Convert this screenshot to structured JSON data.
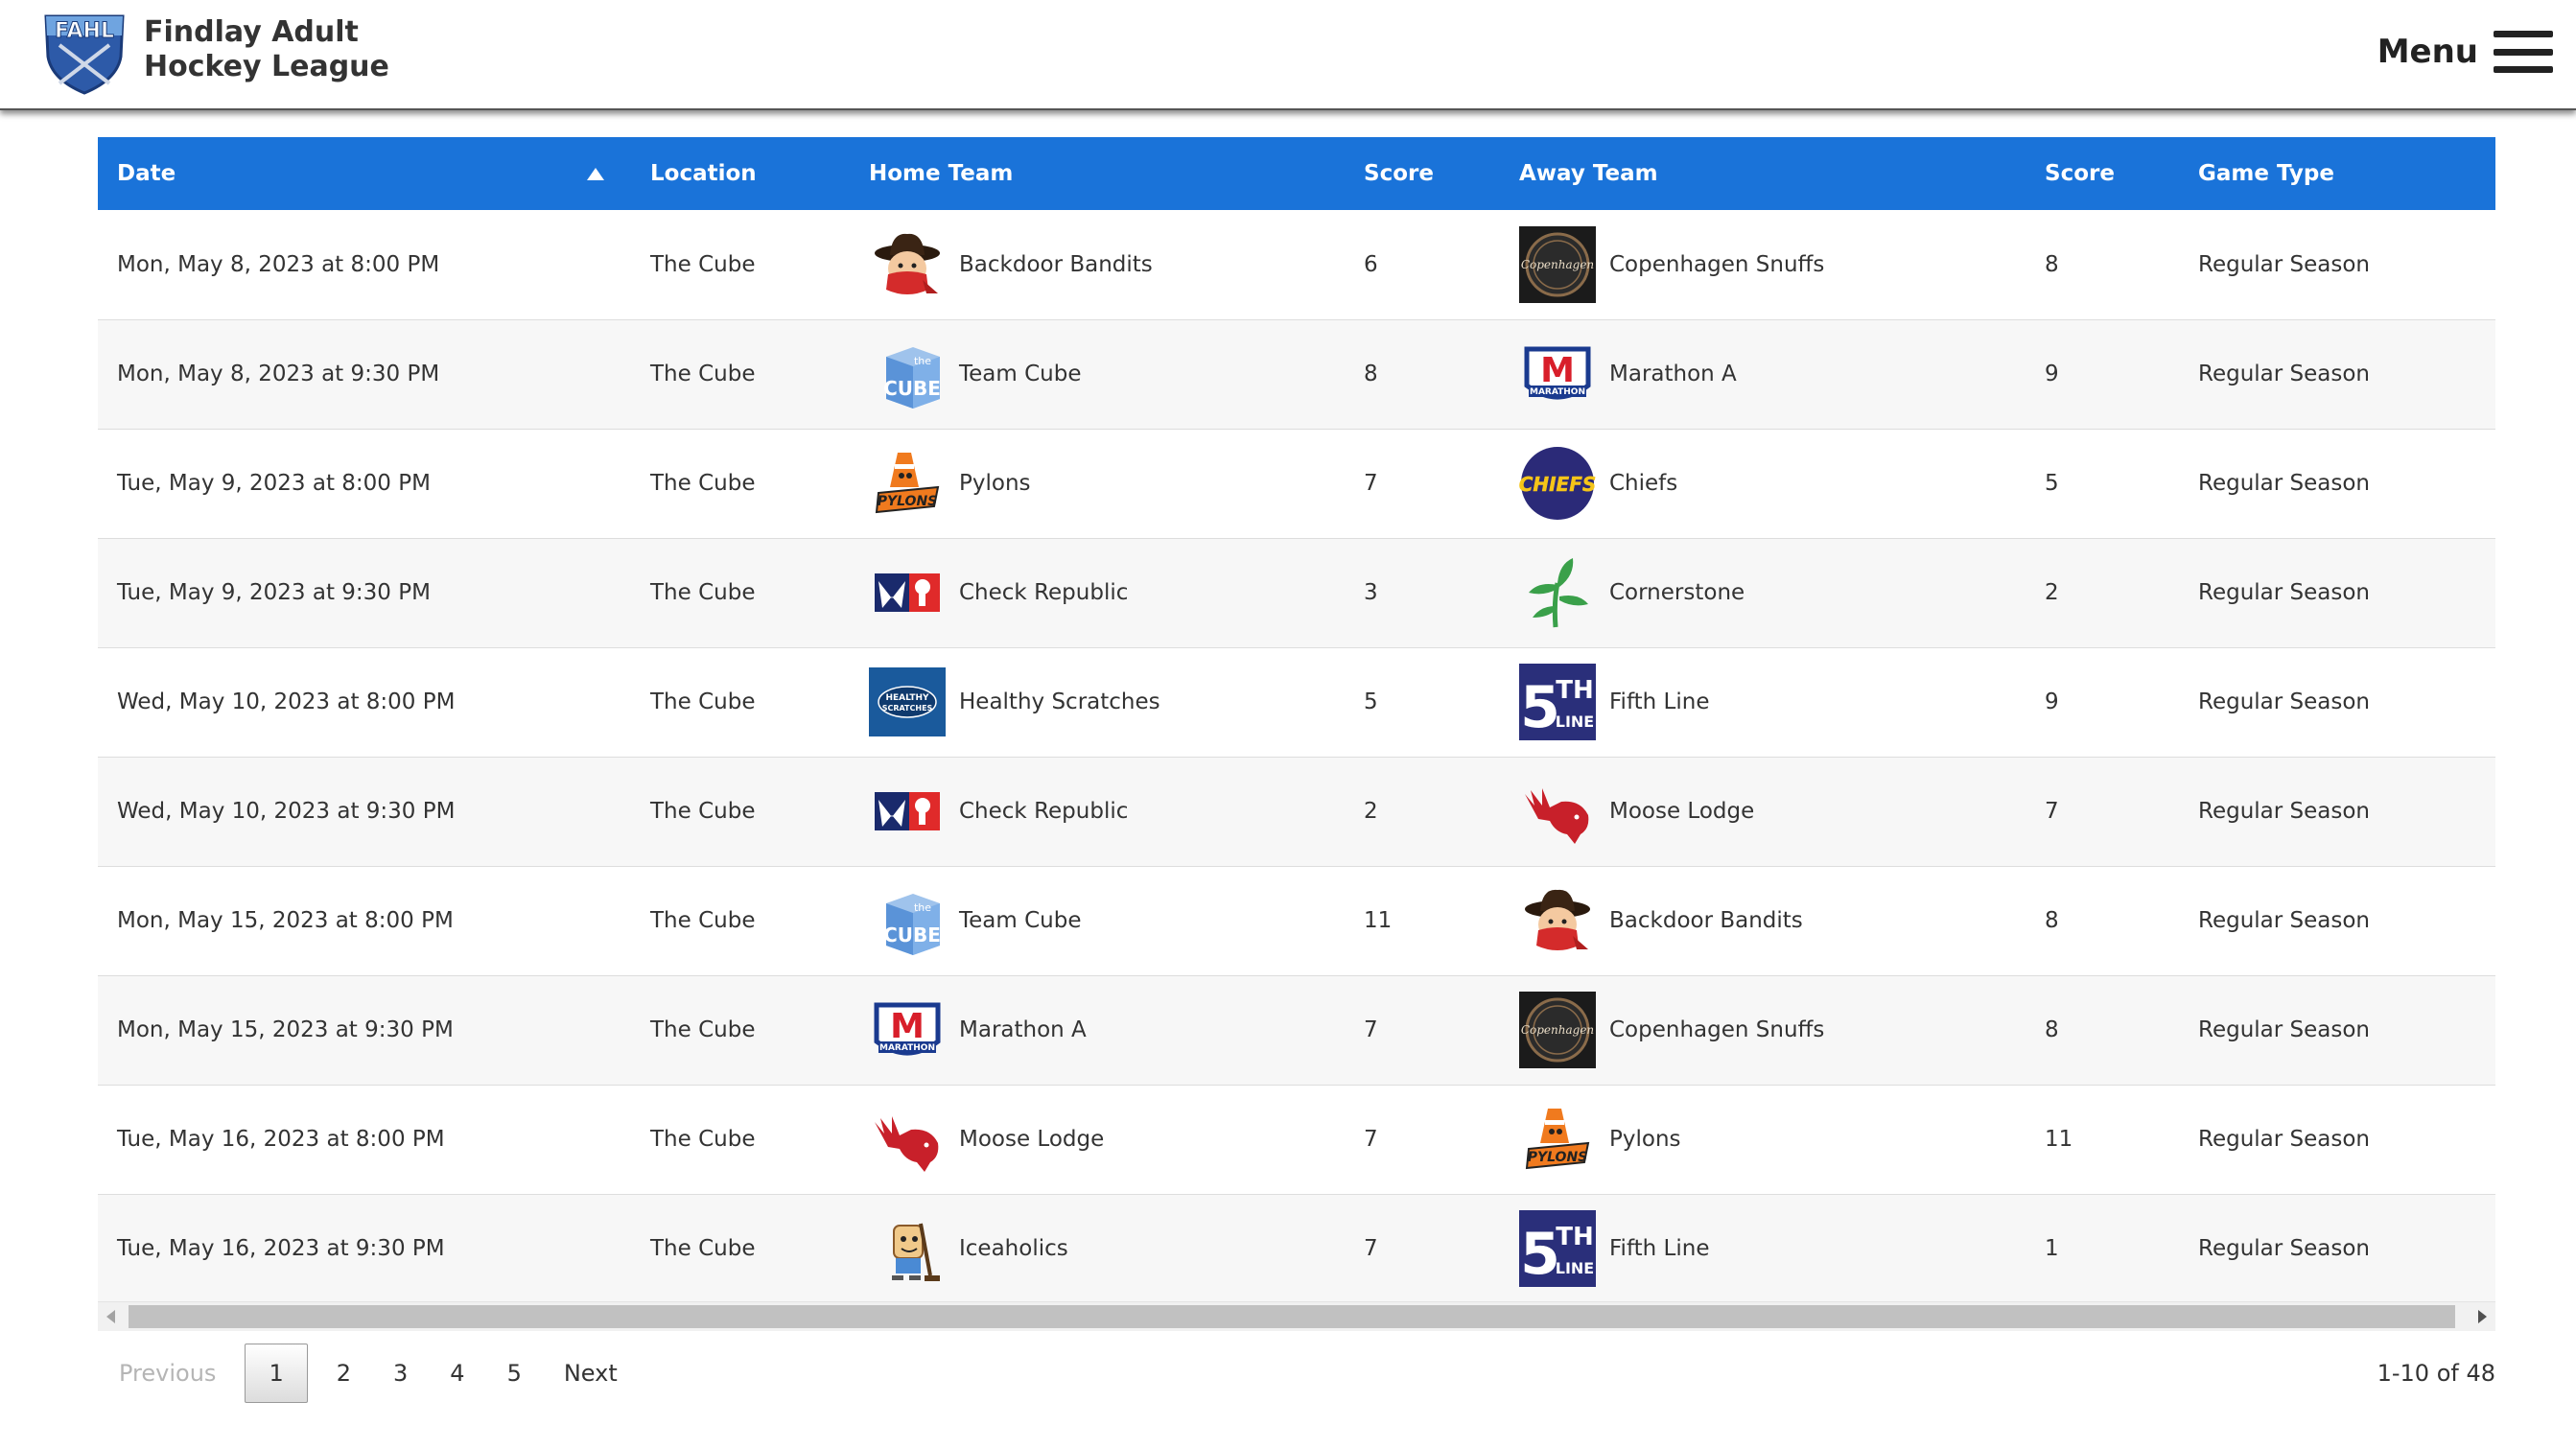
{
  "header": {
    "logo_text": "FAHL",
    "title_line1": "Findlay Adult",
    "title_line2": "Hockey League",
    "menu_label": "Menu"
  },
  "table": {
    "columns": [
      "Date",
      "Location",
      "Home Team",
      "Score",
      "Away Team",
      "Score",
      "Game Type"
    ],
    "sorted_column": "Date",
    "sort_direction": "ascending",
    "rows": [
      {
        "date": "Mon, May 8, 2023 at 8:00 PM",
        "location": "The Cube",
        "home_team": "Backdoor Bandits",
        "home_logo": "backdoor-bandits-logo",
        "home_score": "6",
        "away_team": "Copenhagen Snuffs",
        "away_logo": "copenhagen-snuffs-logo",
        "away_score": "8",
        "game_type": "Regular Season"
      },
      {
        "date": "Mon, May 8, 2023 at 9:30 PM",
        "location": "The Cube",
        "home_team": "Team Cube",
        "home_logo": "team-cube-logo",
        "home_score": "8",
        "away_team": "Marathon A",
        "away_logo": "marathon-logo",
        "away_score": "9",
        "game_type": "Regular Season"
      },
      {
        "date": "Tue, May 9, 2023 at 8:00 PM",
        "location": "The Cube",
        "home_team": "Pylons",
        "home_logo": "pylons-logo",
        "home_score": "7",
        "away_team": "Chiefs",
        "away_logo": "chiefs-logo",
        "away_score": "5",
        "game_type": "Regular Season"
      },
      {
        "date": "Tue, May 9, 2023 at 9:30 PM",
        "location": "The Cube",
        "home_team": "Check Republic",
        "home_logo": "check-republic-logo",
        "home_score": "3",
        "away_team": "Cornerstone",
        "away_logo": "cornerstone-logo",
        "away_score": "2",
        "game_type": "Regular Season"
      },
      {
        "date": "Wed, May 10, 2023 at 8:00 PM",
        "location": "The Cube",
        "home_team": "Healthy Scratches",
        "home_logo": "healthy-scratches-logo",
        "home_score": "5",
        "away_team": "Fifth Line",
        "away_logo": "fifth-line-logo",
        "away_score": "9",
        "game_type": "Regular Season"
      },
      {
        "date": "Wed, May 10, 2023 at 9:30 PM",
        "location": "The Cube",
        "home_team": "Check Republic",
        "home_logo": "check-republic-logo",
        "home_score": "2",
        "away_team": "Moose Lodge",
        "away_logo": "moose-lodge-logo",
        "away_score": "7",
        "game_type": "Regular Season"
      },
      {
        "date": "Mon, May 15, 2023 at 8:00 PM",
        "location": "The Cube",
        "home_team": "Team Cube",
        "home_logo": "team-cube-logo",
        "home_score": "11",
        "away_team": "Backdoor Bandits",
        "away_logo": "backdoor-bandits-logo",
        "away_score": "8",
        "game_type": "Regular Season"
      },
      {
        "date": "Mon, May 15, 2023 at 9:30 PM",
        "location": "The Cube",
        "home_team": "Marathon A",
        "home_logo": "marathon-logo",
        "home_score": "7",
        "away_team": "Copenhagen Snuffs",
        "away_logo": "copenhagen-snuffs-logo",
        "away_score": "8",
        "game_type": "Regular Season"
      },
      {
        "date": "Tue, May 16, 2023 at 8:00 PM",
        "location": "The Cube",
        "home_team": "Moose Lodge",
        "home_logo": "moose-lodge-logo",
        "home_score": "7",
        "away_team": "Pylons",
        "away_logo": "pylons-logo",
        "away_score": "11",
        "game_type": "Regular Season"
      },
      {
        "date": "Tue, May 16, 2023 at 9:30 PM",
        "location": "The Cube",
        "home_team": "Iceaholics",
        "home_logo": "iceaholics-logo",
        "home_score": "7",
        "away_team": "Fifth Line",
        "away_logo": "fifth-line-logo",
        "away_score": "1",
        "game_type": "Regular Season"
      }
    ]
  },
  "logo_text": {
    "copenhagen": "Copenhagen",
    "marathon_m": "M",
    "marathon_word": "MARATHON",
    "chiefs": "CHIEFS",
    "pylons": "PYLONS",
    "fifth_big": "5",
    "fifth_th": "TH",
    "fifth_line": "LINE",
    "cube_the": "the",
    "cube_word": "CUBE",
    "healthy": "HEALTHY",
    "scratches": "SCRATCHES"
  },
  "pagination": {
    "previous": "Previous",
    "pages": [
      "1",
      "2",
      "3",
      "4",
      "5"
    ],
    "current": "1",
    "next": "Next",
    "info": "1-10 of 48"
  },
  "colors": {
    "header_bg": "#1a73d9",
    "row_alt": "#f7f7f7",
    "logo_shield": "#2d5aa8"
  }
}
